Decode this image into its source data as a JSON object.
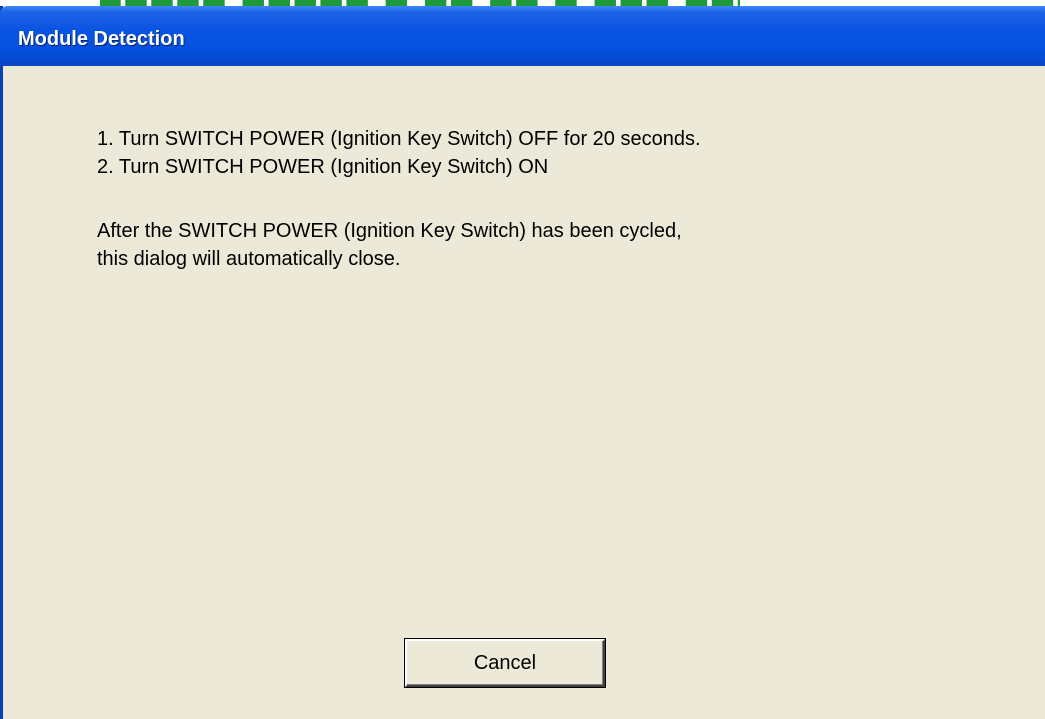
{
  "window": {
    "title": "Module Detection"
  },
  "instructions": {
    "step1": "1. Turn SWITCH POWER (Ignition Key Switch) OFF for 20 seconds.",
    "step2": "2. Turn SWITCH POWER (Ignition Key Switch) ON",
    "note_line1": "After the SWITCH POWER (Ignition Key Switch) has been cycled,",
    "note_line2": "this dialog will automatically close."
  },
  "buttons": {
    "cancel_label": "Cancel"
  },
  "colors": {
    "titlebar": "#0a54e3",
    "dialog_face": "#ece9d8",
    "background_text": "#1f9a3a"
  }
}
